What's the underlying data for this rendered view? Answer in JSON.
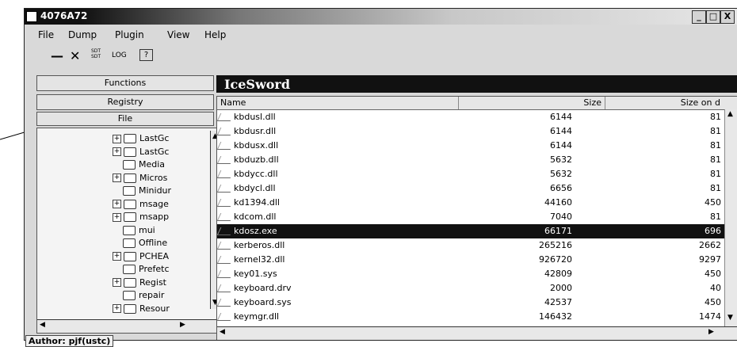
{
  "window": {
    "title": "4076A72",
    "minimize_label": "_",
    "maximize_label": "□",
    "close_label": "X"
  },
  "menu": [
    "File",
    "Dump",
    "Plugin",
    "View",
    "Help"
  ],
  "toolbar": {
    "minus_label": "—",
    "close_label": "✕",
    "sdt_label": "SDT\nSDT",
    "log_label": "LOG",
    "help_label": "?"
  },
  "sidebar": {
    "functions_label": "Functions",
    "registry_label": "Registry",
    "file_label": "File"
  },
  "tree": {
    "items": [
      {
        "label": "LastGc",
        "expandable": true
      },
      {
        "label": "LastGc",
        "expandable": true
      },
      {
        "label": "Media",
        "expandable": false
      },
      {
        "label": "Micros",
        "expandable": true
      },
      {
        "label": "Minidur",
        "expandable": false
      },
      {
        "label": "msage",
        "expandable": true
      },
      {
        "label": "msapp",
        "expandable": true
      },
      {
        "label": "mui",
        "expandable": false
      },
      {
        "label": "Offline",
        "expandable": false
      },
      {
        "label": "PCHEA",
        "expandable": true
      },
      {
        "label": "Prefetc",
        "expandable": false
      },
      {
        "label": "Regist",
        "expandable": true
      },
      {
        "label": "repair",
        "expandable": false
      },
      {
        "label": "Resour",
        "expandable": true
      }
    ]
  },
  "brand": "IceSword",
  "file_list": {
    "columns": {
      "name": "Name",
      "size": "Size",
      "size_on_disk": "Size on d"
    },
    "rows": [
      {
        "name": "kbdusl.dll",
        "size": "6144",
        "size_on_disk": "81"
      },
      {
        "name": "kbdusr.dll",
        "size": "6144",
        "size_on_disk": "81"
      },
      {
        "name": "kbdusx.dll",
        "size": "6144",
        "size_on_disk": "81"
      },
      {
        "name": "kbduzb.dll",
        "size": "5632",
        "size_on_disk": "81"
      },
      {
        "name": "kbdycc.dll",
        "size": "5632",
        "size_on_disk": "81"
      },
      {
        "name": "kbdycl.dll",
        "size": "6656",
        "size_on_disk": "81"
      },
      {
        "name": "kd1394.dll",
        "size": "44160",
        "size_on_disk": "450"
      },
      {
        "name": "kdcom.dll",
        "size": "7040",
        "size_on_disk": "81"
      },
      {
        "name": "kdosz.exe",
        "size": "66171",
        "size_on_disk": "696",
        "selected": true
      },
      {
        "name": "kerberos.dll",
        "size": "265216",
        "size_on_disk": "2662"
      },
      {
        "name": "kernel32.dll",
        "size": "926720",
        "size_on_disk": "9297"
      },
      {
        "name": "key01.sys",
        "size": "42809",
        "size_on_disk": "450"
      },
      {
        "name": "keyboard.drv",
        "size": "2000",
        "size_on_disk": "40"
      },
      {
        "name": "keyboard.sys",
        "size": "42537",
        "size_on_disk": "450"
      },
      {
        "name": "keymgr.dll",
        "size": "146432",
        "size_on_disk": "1474"
      }
    ]
  },
  "status": {
    "author": "Author: pjf(ustc)"
  }
}
